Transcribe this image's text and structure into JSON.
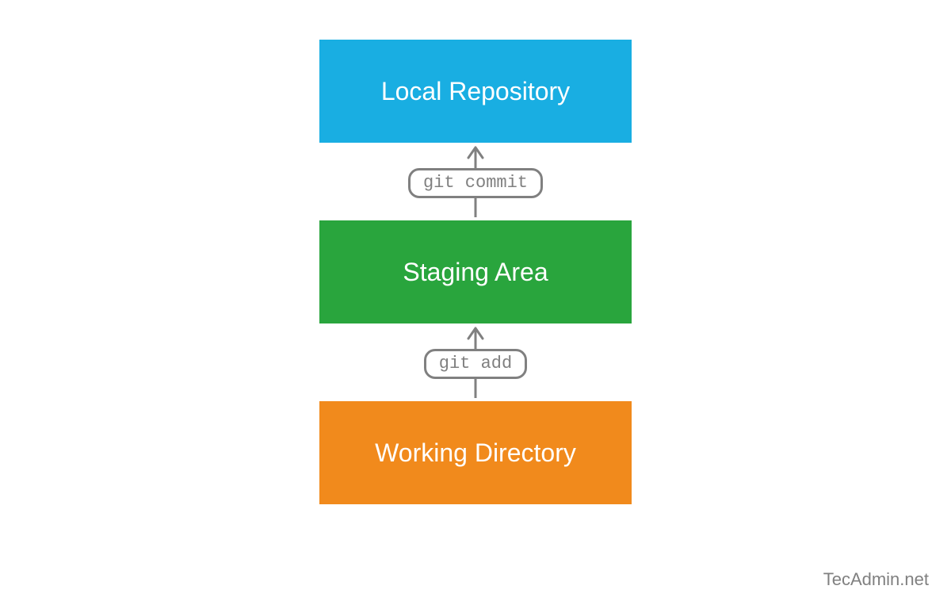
{
  "colors": {
    "blue": "#19AEE2",
    "green": "#29A53D",
    "orange": "#F18A1C",
    "gray": "#808080"
  },
  "boxes": {
    "top": {
      "label": "Local Repository"
    },
    "middle": {
      "label": "Staging Area"
    },
    "bottom": {
      "label": "Working Directory"
    }
  },
  "arrows": {
    "upper": {
      "command": "git commit"
    },
    "lower": {
      "command": "git add"
    }
  },
  "attribution": "TecAdmin.net"
}
